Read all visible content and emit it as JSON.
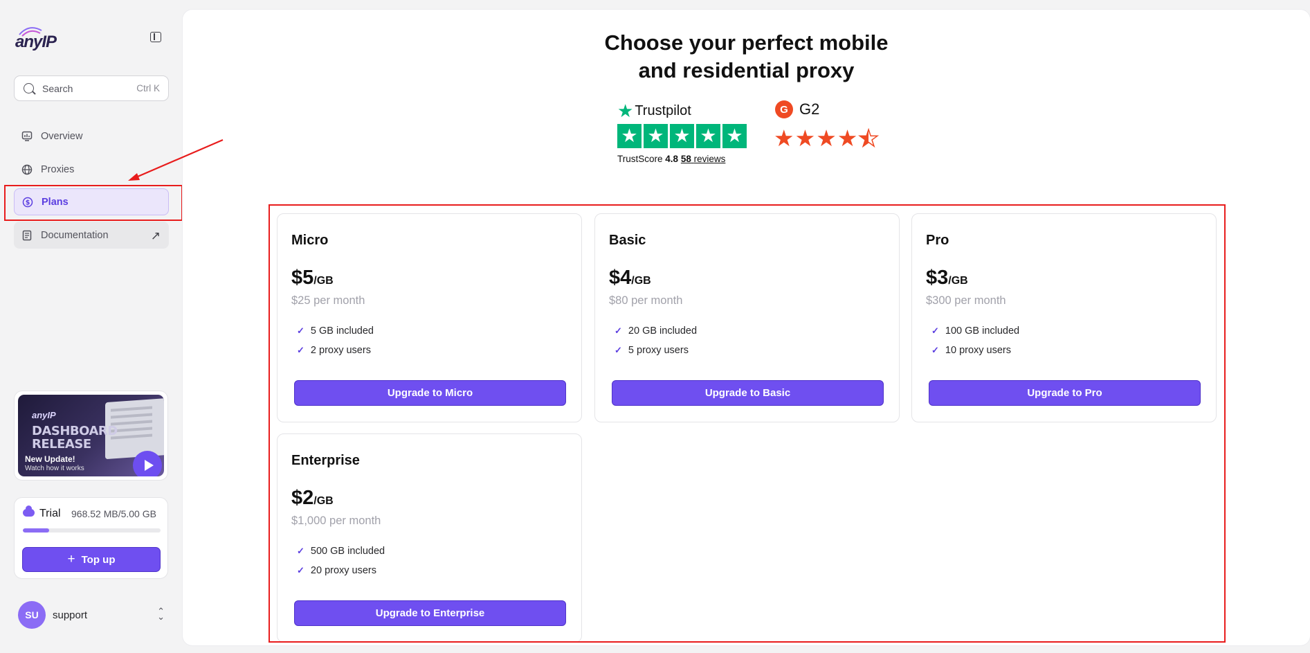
{
  "sidebar": {
    "logo": "anyIP",
    "search": {
      "placeholder": "Search",
      "shortcut": "Ctrl K"
    },
    "nav": [
      {
        "label": "Overview",
        "icon": "chart-icon"
      },
      {
        "label": "Proxies",
        "icon": "globe-icon"
      },
      {
        "label": "Plans",
        "icon": "dollar-icon",
        "active": true
      },
      {
        "label": "Documentation",
        "icon": "document-icon",
        "external": true
      }
    ],
    "video": {
      "brand": "anyIP",
      "title_line1": "DASHBOARD",
      "title_line2": "RELEASE",
      "headline": "New Update!",
      "subline": "Watch how it works"
    },
    "trial": {
      "title": "Trial",
      "usage": "968.52 MB/5.00 GB",
      "progress": 0.19,
      "button": "Top up"
    },
    "user": {
      "initials": "SU",
      "name": "support"
    }
  },
  "main": {
    "title_line1": "Choose your perfect mobile",
    "title_line2": "and residential proxy",
    "trustpilot": {
      "name": "Trustpilot",
      "score_label": "TrustScore",
      "score": "4.8",
      "reviews_count": "58",
      "reviews_label": "reviews"
    },
    "g2": {
      "name": "G2",
      "rating": 4.5
    },
    "plans": [
      {
        "name": "Micro",
        "price": "$5",
        "unit": "/GB",
        "monthly": "$25 per month",
        "features": [
          "5 GB included",
          "2 proxy users"
        ],
        "button": "Upgrade to Micro"
      },
      {
        "name": "Basic",
        "price": "$4",
        "unit": "/GB",
        "monthly": "$80 per month",
        "features": [
          "20 GB included",
          "5 proxy users"
        ],
        "button": "Upgrade to Basic"
      },
      {
        "name": "Pro",
        "price": "$3",
        "unit": "/GB",
        "monthly": "$300 per month",
        "features": [
          "100 GB included",
          "10 proxy users"
        ],
        "button": "Upgrade to Pro"
      },
      {
        "name": "Enterprise",
        "price": "$2",
        "unit": "/GB",
        "monthly": "$1,000 per month",
        "features": [
          "500 GB included",
          "20 proxy users"
        ],
        "button": "Upgrade to Enterprise"
      }
    ]
  },
  "colors": {
    "accent": "#6f4ff0",
    "annotation": "#e81c1c",
    "trustpilot": "#00b67a",
    "g2": "#ef4a23"
  }
}
